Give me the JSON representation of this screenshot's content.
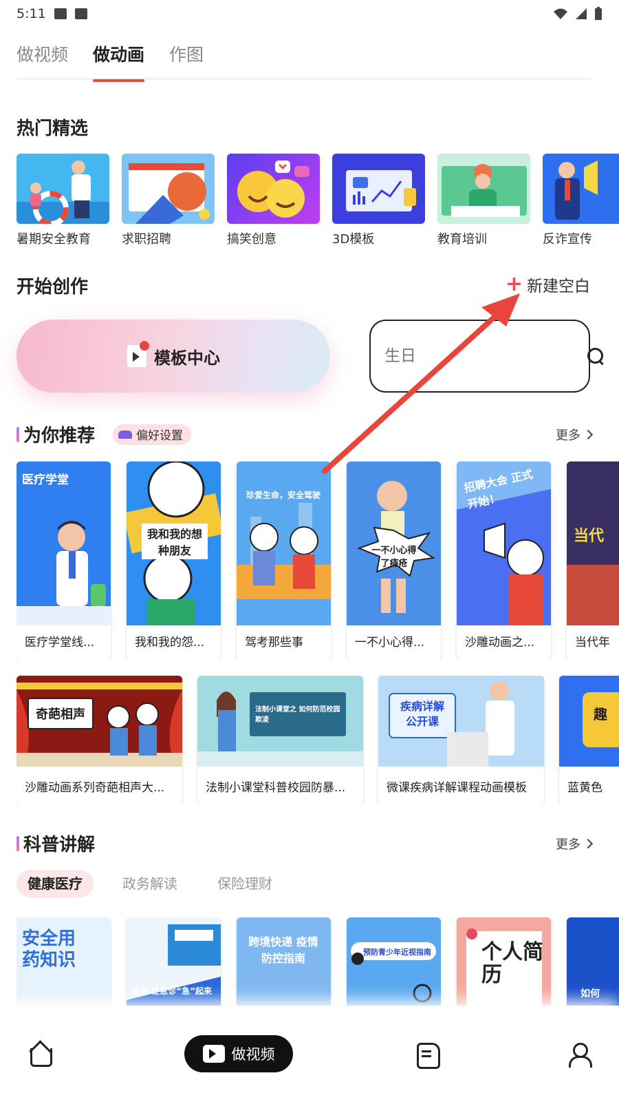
{
  "status_bar": {
    "time": "5:11"
  },
  "top_tabs": [
    {
      "label": "做视频"
    },
    {
      "label": "做动画"
    },
    {
      "label": "作图"
    }
  ],
  "hot": {
    "title": "热门精选",
    "items": [
      {
        "label": "暑期安全教育",
        "color": "#44b6f0"
      },
      {
        "label": "求职招聘",
        "color": "#f5c75a"
      },
      {
        "label": "搞笑创意",
        "color": "#9b3ff0"
      },
      {
        "label": "3D模板",
        "color": "#3b3fe0"
      },
      {
        "label": "教育培训",
        "color": "#c8f0dc"
      },
      {
        "label": "反诈宣传",
        "color": "#2e6ff0"
      }
    ]
  },
  "create": {
    "title": "开始创作",
    "new_blank": "新建空白",
    "template_center": "模板中心",
    "search_placeholder": "生日"
  },
  "recommend": {
    "title": "为你推荐",
    "pref_badge": "偏好设置",
    "more": "更多",
    "cards": [
      {
        "label": "医疗学堂线...",
        "color": "#2f7ff0",
        "thumb_text": "医疗学堂"
      },
      {
        "label": "我和我的怨...",
        "color": "#2f8ff0",
        "thumb_text": "我和我的想种朋友"
      },
      {
        "label": "驾考那些事",
        "color": "#5aa8f0",
        "thumb_text": "珍爱生命，安全驾驶"
      },
      {
        "label": "一不小心得...",
        "color": "#4a90e8",
        "thumb_text": "一不小心得了痔疮"
      },
      {
        "label": "沙雕动画之...",
        "color": "#5a7ff0",
        "thumb_text": "招聘大会 正式开始！"
      },
      {
        "label": "当代年",
        "color": "#3a3060",
        "thumb_text": "当代"
      }
    ],
    "wide_cards": [
      {
        "label": "沙雕动画系列奇葩相声大...",
        "color": "#c83a2a",
        "thumb_text": "奇葩相声"
      },
      {
        "label": "法制小课堂科普校园防暴...",
        "color": "#9fdbe0",
        "thumb_text": "法制小课堂之 如何防范校园欺凌"
      },
      {
        "label": "微课疾病详解课程动画模板",
        "color": "#a8d0f5",
        "thumb_text": "疾病详解 公开课"
      },
      {
        "label": "蓝黄色",
        "color": "#2f6ff0",
        "thumb_text": "趣"
      }
    ]
  },
  "science": {
    "title": "科普讲解",
    "more": "更多",
    "chips": [
      {
        "label": "健康医疗"
      },
      {
        "label": "政务解读"
      },
      {
        "label": "保险理财"
      }
    ],
    "cards": [
      {
        "text": "安全用药知识",
        "color": "#e6f2fc"
      },
      {
        "text": "急诊 让急诊“急”起来",
        "color": "#eef6fb"
      },
      {
        "text": "跨境快递 疫情防控指南",
        "color": "#7fb8f0"
      },
      {
        "text": "预防青少年近视指南",
        "color": "#5aa8f0"
      },
      {
        "text": "个人简历",
        "color": "#f5a8a0"
      },
      {
        "text": "如何",
        "color": "#1a50c8"
      }
    ]
  },
  "bottom_nav": {
    "make_video": "做视频"
  }
}
